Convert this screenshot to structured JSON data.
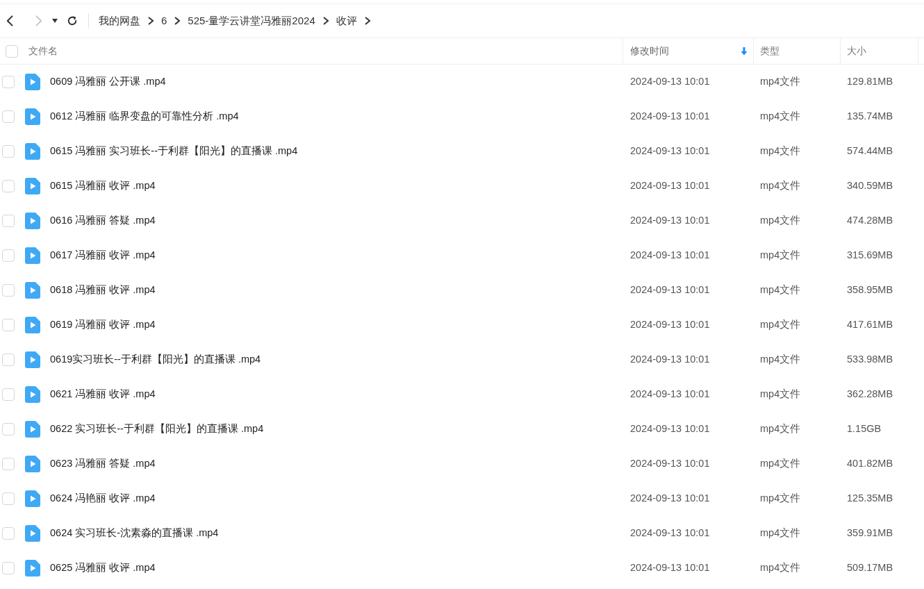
{
  "nav": {
    "back_disabled": false,
    "forward_disabled": true
  },
  "breadcrumb": [
    {
      "label": "我的网盘"
    },
    {
      "label": "6"
    },
    {
      "label": "525-量学云讲堂冯雅丽2024"
    },
    {
      "label": "收评"
    }
  ],
  "table": {
    "select_all_checked": false,
    "columns": [
      {
        "label": "文件名",
        "sorted": false
      },
      {
        "label": "修改时间",
        "sorted": true
      },
      {
        "label": "类型",
        "sorted": false
      },
      {
        "label": "大小",
        "sorted": false
      }
    ],
    "rows": [
      {
        "name": "0609 冯雅丽 公开课 .mp4",
        "modified": "2024-09-13 10:01",
        "type": "mp4文件",
        "size": "129.81MB",
        "checked": false
      },
      {
        "name": "0612 冯雅丽 临界变盘的可靠性分析 .mp4",
        "modified": "2024-09-13 10:01",
        "type": "mp4文件",
        "size": "135.74MB",
        "checked": false
      },
      {
        "name": "0615 冯雅丽 实习班长--于利群【阳光】的直播课 .mp4",
        "modified": "2024-09-13 10:01",
        "type": "mp4文件",
        "size": "574.44MB",
        "checked": false
      },
      {
        "name": "0615 冯雅丽 收评 .mp4",
        "modified": "2024-09-13 10:01",
        "type": "mp4文件",
        "size": "340.59MB",
        "checked": false
      },
      {
        "name": "0616 冯雅丽 答疑 .mp4",
        "modified": "2024-09-13 10:01",
        "type": "mp4文件",
        "size": "474.28MB",
        "checked": false
      },
      {
        "name": "0617 冯雅丽 收评 .mp4",
        "modified": "2024-09-13 10:01",
        "type": "mp4文件",
        "size": "315.69MB",
        "checked": false
      },
      {
        "name": "0618 冯雅丽 收评 .mp4",
        "modified": "2024-09-13 10:01",
        "type": "mp4文件",
        "size": "358.95MB",
        "checked": false
      },
      {
        "name": "0619 冯雅丽 收评 .mp4",
        "modified": "2024-09-13 10:01",
        "type": "mp4文件",
        "size": "417.61MB",
        "checked": false
      },
      {
        "name": "0619实习班长--于利群【阳光】的直播课 .mp4",
        "modified": "2024-09-13 10:01",
        "type": "mp4文件",
        "size": "533.98MB",
        "checked": false
      },
      {
        "name": "0621 冯雅丽 收评 .mp4",
        "modified": "2024-09-13 10:01",
        "type": "mp4文件",
        "size": "362.28MB",
        "checked": false
      },
      {
        "name": "0622 实习班长--于利群【阳光】的直播课 .mp4",
        "modified": "2024-09-13 10:01",
        "type": "mp4文件",
        "size": "1.15GB",
        "checked": false
      },
      {
        "name": "0623 冯雅丽 答疑 .mp4",
        "modified": "2024-09-13 10:01",
        "type": "mp4文件",
        "size": "401.82MB",
        "checked": false
      },
      {
        "name": "0624 冯艳丽 收评 .mp4",
        "modified": "2024-09-13 10:01",
        "type": "mp4文件",
        "size": "125.35MB",
        "checked": false
      },
      {
        "name": "0624 实习班长-沈素淼的直播课 .mp4",
        "modified": "2024-09-13 10:01",
        "type": "mp4文件",
        "size": "359.91MB",
        "checked": false
      },
      {
        "name": "0625 冯雅丽 收评 .mp4",
        "modified": "2024-09-13 10:01",
        "type": "mp4文件",
        "size": "509.17MB",
        "checked": false
      }
    ]
  }
}
